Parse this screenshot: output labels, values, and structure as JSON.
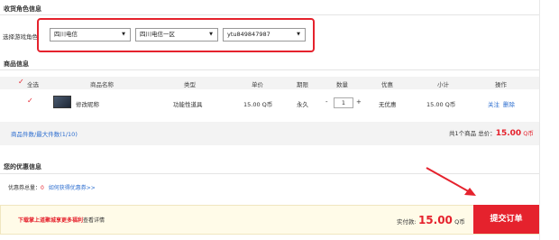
{
  "role_section": {
    "title": "收货角色信息",
    "label": "选择游戏角色",
    "select_game": "四川电信",
    "select_server": "四川电信一区",
    "select_role": "ytu849847987"
  },
  "goods_section": {
    "title": "商品信息",
    "headers": {
      "select_all": "全选",
      "name": "商品名称",
      "type": "类型",
      "price": "单价",
      "period": "期限",
      "qty": "数量",
      "discount": "优惠",
      "subtotal": "小计",
      "actions": "操作"
    },
    "row": {
      "name": "修改昵称",
      "type": "功能性道具",
      "price": "15.00 Q币",
      "period": "永久",
      "qty_minus": "-",
      "qty": "1",
      "qty_plus": "+",
      "discount": "无优惠",
      "subtotal": "15.00 Q币",
      "action_follow": "关注",
      "action_delete": "删除"
    },
    "summary_left": "商品件数/最大件数(1/10)",
    "summary_right_prefix": "共1个商品 总价：",
    "summary_total": "15.00",
    "summary_unit": "Q币"
  },
  "coupon_section": {
    "title": "您的优惠信息",
    "count_label": "优惠券总量：",
    "count_value": "0",
    "link": "如何获得优惠券>>"
  },
  "footer": {
    "promo_prefix": "下载掌上道聚城",
    "promo_bold": "享更多福利",
    "promo_suffix": "查看详情",
    "pay_label": "实付款:",
    "pay_amount": "15.00",
    "pay_unit": "Q币",
    "submit": "提交订单"
  },
  "colors": {
    "accent_red": "#e5222d",
    "link_blue": "#2a6ccf"
  }
}
